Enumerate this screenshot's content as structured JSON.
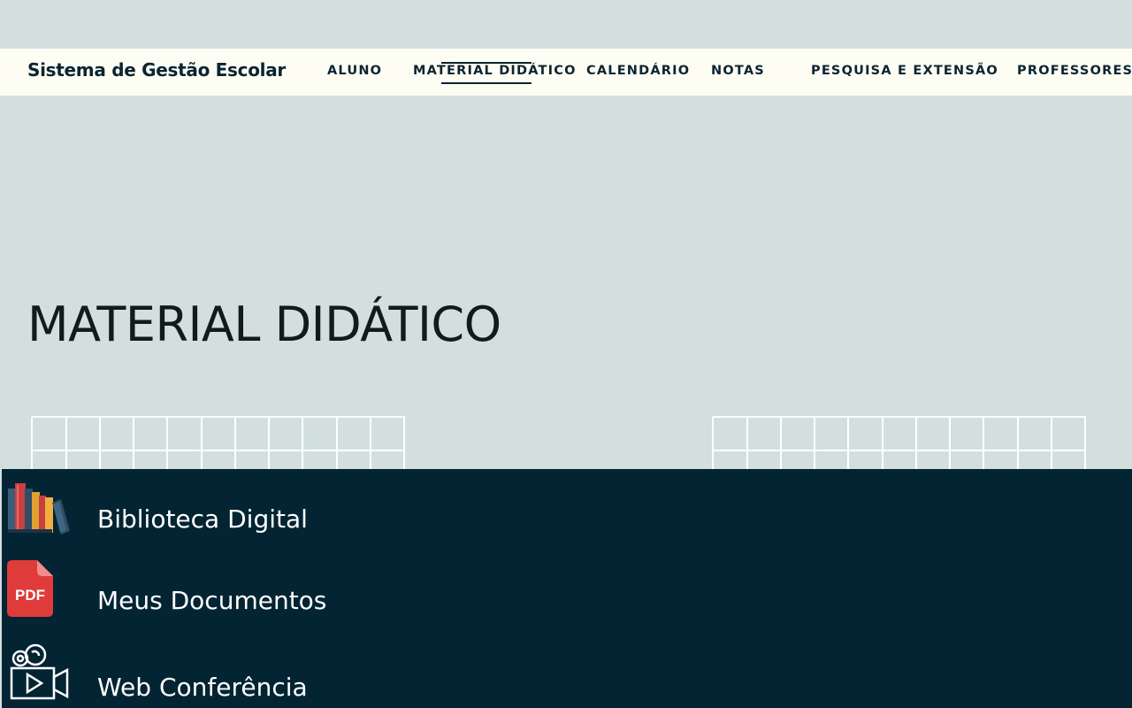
{
  "header": {
    "brand": "Sistema de Gestão Escolar",
    "nav": [
      {
        "label": "ALUNO"
      },
      {
        "label": "MATERIAL DIDÁTICO",
        "active": true
      },
      {
        "label": "CALENDÁRIO"
      },
      {
        "label": "NOTAS"
      },
      {
        "label": "PESQUISA E EXTENSÃO"
      },
      {
        "label": "PROFESSORES"
      }
    ]
  },
  "main": {
    "title": "MATERIAL DIDÁTICO"
  },
  "resources": {
    "items": [
      {
        "label": "Biblioteca Digital",
        "icon": "books-icon"
      },
      {
        "label": "Meus Documentos",
        "icon": "pdf-file-icon",
        "icon_text": "PDF"
      },
      {
        "label": "Web Conferência",
        "icon": "video-camera-icon"
      }
    ]
  },
  "colors": {
    "background": "#d3dfdf",
    "navbar": "#fdfdf3",
    "panel": "#032433",
    "text_dark": "#0b2431",
    "pdf_red": "#e03b3b"
  }
}
